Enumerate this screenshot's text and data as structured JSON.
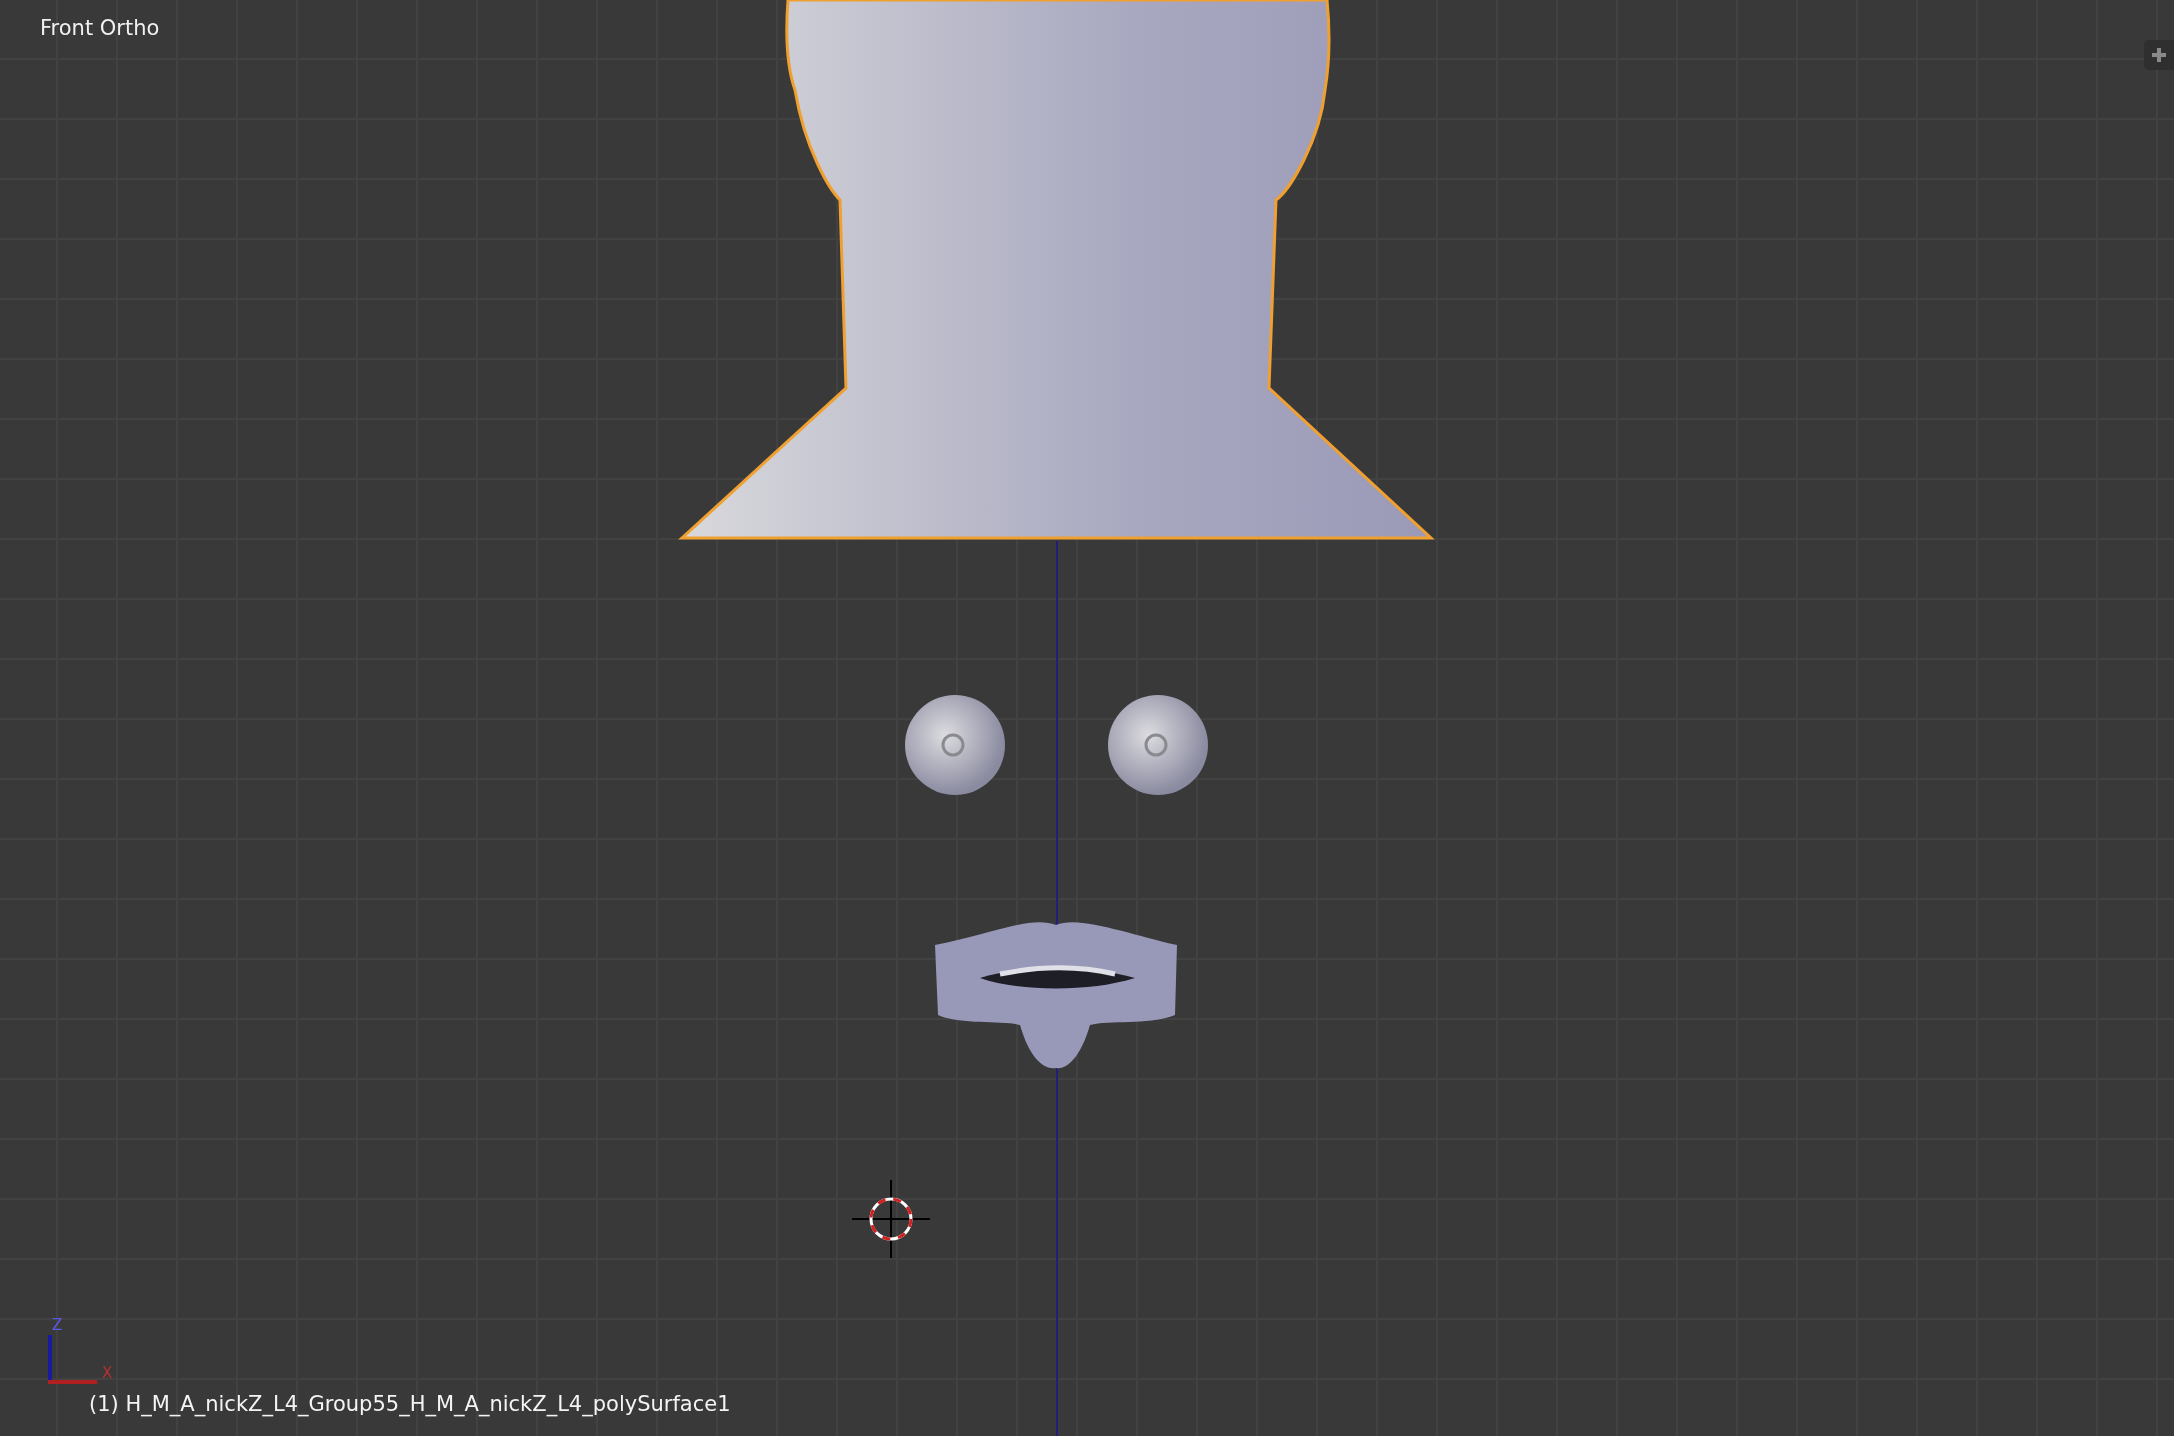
{
  "view": {
    "title": "Front Ortho"
  },
  "objects": [
    {
      "kind": "head",
      "selected": true
    },
    {
      "kind": "eye",
      "selected": false
    },
    {
      "kind": "eye",
      "selected": false
    },
    {
      "kind": "mouth",
      "selected": false
    }
  ],
  "axes": {
    "vertical": "Z",
    "horizontal": "X"
  },
  "status": {
    "object_name": "(1) H_M_A_nickZ_L4_Group55_H_M_A_nickZ_L4_polySurface1"
  }
}
